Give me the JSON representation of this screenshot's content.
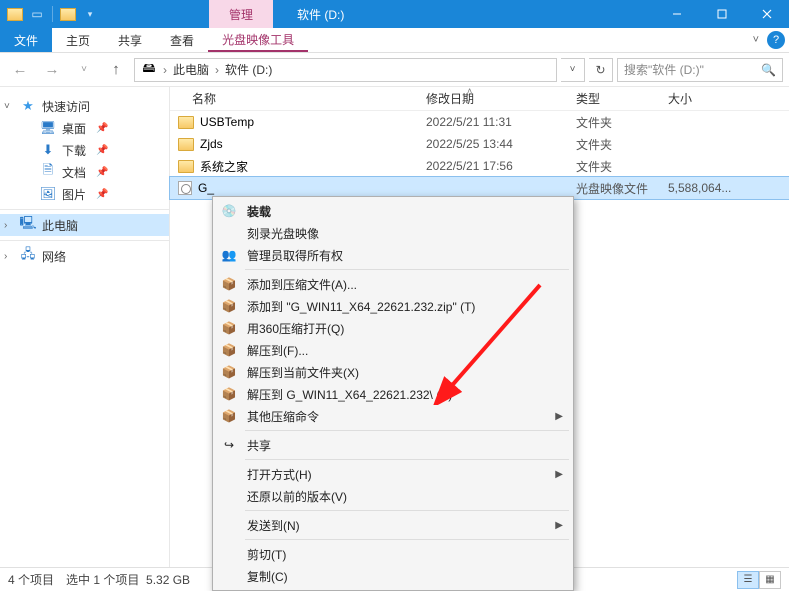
{
  "window": {
    "manage_tab": "管理",
    "drive_title": "软件 (D:)",
    "ribbon": {
      "file": "文件",
      "home": "主页",
      "share": "共享",
      "view": "查看",
      "disc_tools": "光盘映像工具"
    },
    "search_placeholder": "搜索\"软件 (D:)\""
  },
  "breadcrumb": {
    "root": "此电脑",
    "drive": "软件 (D:)"
  },
  "nav": {
    "quick_access": "快速访问",
    "desktop": "桌面",
    "downloads": "下载",
    "documents": "文档",
    "pictures": "图片",
    "this_pc": "此电脑",
    "network": "网络"
  },
  "columns": {
    "name": "名称",
    "date": "修改日期",
    "type": "类型",
    "size": "大小"
  },
  "files": [
    {
      "name": "USBTemp",
      "date": "2022/5/21 11:31",
      "type": "文件夹",
      "size": ""
    },
    {
      "name": "Zjds",
      "date": "2022/5/25 13:44",
      "type": "文件夹",
      "size": ""
    },
    {
      "name": "系统之家",
      "date": "2022/5/21 17:56",
      "type": "文件夹",
      "size": ""
    },
    {
      "name": "G_",
      "date": "",
      "type": "光盘映像文件",
      "size": "5,588,064..."
    }
  ],
  "context_menu": {
    "mount": "装载",
    "burn": "刻录光盘映像",
    "admin": "管理员取得所有权",
    "add_archive": "添加到压缩文件(A)...",
    "add_zip": "添加到 \"G_WIN11_X64_22621.232.zip\" (T)",
    "open_360": "用360压缩打开(Q)",
    "extract_to": "解压到(F)...",
    "extract_here": "解压到当前文件夹(X)",
    "extract_named": "解压到 G_WIN11_X64_22621.232\\ (E)",
    "other_compress": "其他压缩命令",
    "share": "共享",
    "open_with": "打开方式(H)",
    "restore": "还原以前的版本(V)",
    "send_to": "发送到(N)",
    "cut": "剪切(T)",
    "copy": "复制(C)"
  },
  "status": {
    "count": "4 个项目",
    "selection": "选中 1 个项目",
    "size": "5.32 GB"
  }
}
